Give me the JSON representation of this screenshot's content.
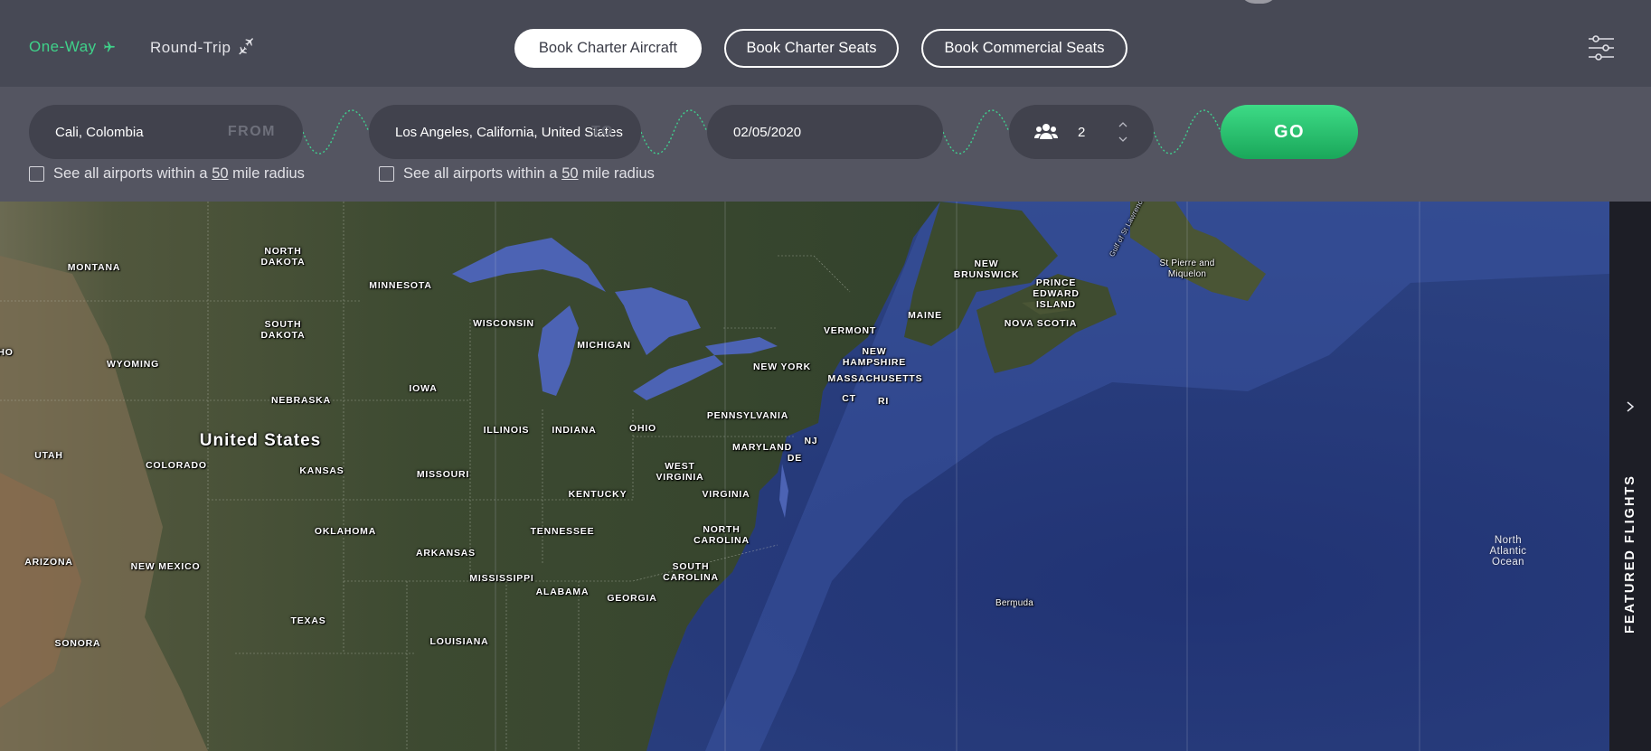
{
  "trip_types": {
    "one_way": "One-Way",
    "round_trip": "Round-Trip",
    "active": "one_way",
    "active_color": "#3fd28a"
  },
  "booking_tabs": [
    {
      "label": "Book Charter Aircraft",
      "active": true
    },
    {
      "label": "Book Charter Seats",
      "active": false
    },
    {
      "label": "Book Commercial Seats",
      "active": false
    }
  ],
  "icons": {
    "one_way": "airplane-icon",
    "round_trip": "round-trip-planes-icon",
    "filters": "sliders-icon",
    "passengers": "people-group-icon",
    "stepper": "chevron-up-down-icon",
    "featured": "chevron-right-icon"
  },
  "search": {
    "from": {
      "value": "Cali, Colombia",
      "tag": "FROM"
    },
    "to": {
      "value": "Los Angeles, California, United States",
      "tag": "TO"
    },
    "date": {
      "value": "02/05/2020"
    },
    "passengers": {
      "value": "2"
    },
    "go_label": "GO",
    "go_color": "#22bb6c",
    "radius_from": {
      "prefix": "See all airports within a",
      "miles": "50",
      "suffix": "mile radius",
      "checked": false
    },
    "radius_to": {
      "prefix": "See all airports within a",
      "miles": "50",
      "suffix": "mile radius",
      "checked": false
    }
  },
  "map": {
    "labels": {
      "montana": "MONTANA",
      "north_dakota": "NORTH\nDAKOTA",
      "minnesota": "MINNESOTA",
      "south_dakota": "SOUTH\nDAKOTA",
      "wisconsin": "WISCONSIN",
      "michigan": "MICHIGAN",
      "wyoming": "WYOMING",
      "idaho_fragment": "HO",
      "iowa": "IOWA",
      "nebraska": "NEBRASKA",
      "united_states": "United States",
      "illinois": "ILLINOIS",
      "indiana": "INDIANA",
      "ohio": "OHIO",
      "utah": "UTAH",
      "colorado": "COLORADO",
      "kansas": "KANSAS",
      "missouri": "MISSOURI",
      "kentucky": "KENTUCKY",
      "west_virginia": "WEST\nVIRGINIA",
      "virginia": "VIRGINIA",
      "oklahoma": "OKLAHOMA",
      "tennessee": "TENNESSEE",
      "north_carolina": "NORTH\nCAROLINA",
      "arkansas": "ARKANSAS",
      "arizona": "ARIZONA",
      "new_mexico": "NEW MEXICO",
      "mississippi": "MISSISSIPPI",
      "south_carolina": "SOUTH\nCAROLINA",
      "alabama": "ALABAMA",
      "georgia": "GEORGIA",
      "texas": "TEXAS",
      "sonora": "SONORA",
      "louisiana": "LOUISIANA",
      "pennsylvania": "PENNSYLVANIA",
      "maryland": "MARYLAND",
      "nj": "NJ",
      "de": "DE",
      "new_york": "NEW YORK",
      "ct": "CT",
      "ri": "RI",
      "massachusetts": "MASSACHUSETTS",
      "new_hampshire": "NEW\nHAMPSHIRE",
      "vermont": "VERMONT",
      "maine": "MAINE",
      "new_brunswick": "NEW\nBRUNSWICK",
      "pei": "PRINCE\nEDWARD\nISLAND",
      "nova_scotia": "NOVA SCOTIA",
      "st_pierre": "St Pierre and\nMiquelon",
      "gulf": "Gulf of St Lawrence",
      "bermuda": "Bermuda",
      "north_atlantic": "North\nAtlantic\nOcean"
    }
  },
  "featured_flights": "FEATURED FLIGHTS"
}
